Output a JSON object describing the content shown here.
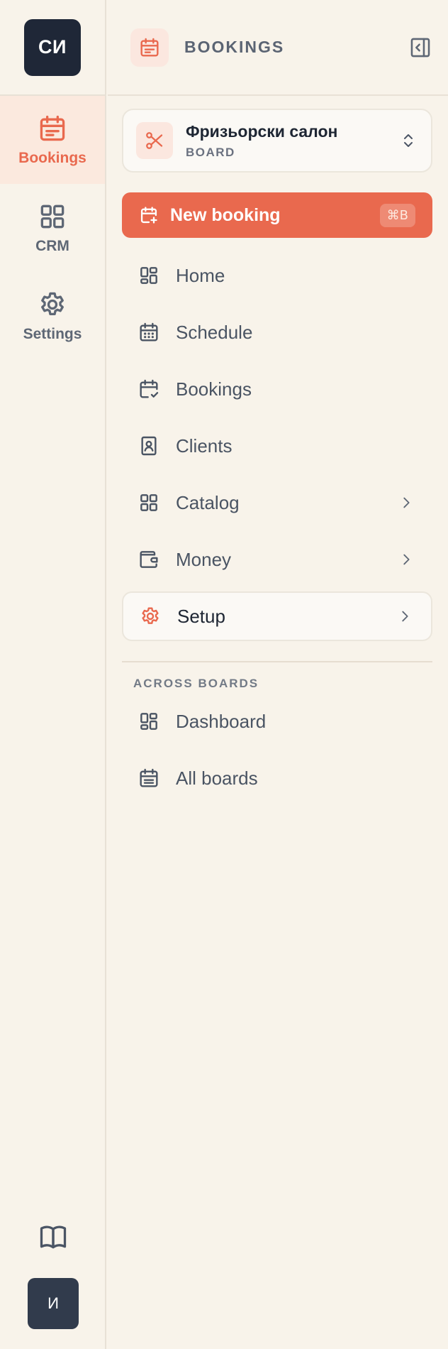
{
  "rail": {
    "logo": "СИ",
    "items": [
      {
        "label": "Bookings",
        "icon": "calendar-icon",
        "active": true
      },
      {
        "label": "CRM",
        "icon": "grid-icon",
        "active": false
      },
      {
        "label": "Settings",
        "icon": "gear-icon",
        "active": false
      }
    ],
    "bottom": {
      "help_icon": "book-icon",
      "avatar": "И"
    }
  },
  "header": {
    "icon": "calendar-icon",
    "title": "BOOKINGS",
    "collapse_icon": "collapse-sidebar-icon"
  },
  "board": {
    "name": "Фризьорски салон",
    "subtitle": "BOARD",
    "icon": "scissors-icon"
  },
  "new_booking": {
    "label": "New booking",
    "shortcut": "⌘B",
    "icon": "calendar-plus-icon"
  },
  "nav": [
    {
      "label": "Home",
      "icon": "dashboard-icon"
    },
    {
      "label": "Schedule",
      "icon": "calendar-grid-icon"
    },
    {
      "label": "Bookings",
      "icon": "calendar-check-icon"
    },
    {
      "label": "Clients",
      "icon": "contact-book-icon"
    },
    {
      "label": "Catalog",
      "icon": "grid-icon",
      "has_children": true
    },
    {
      "label": "Money",
      "icon": "wallet-icon",
      "has_children": true
    },
    {
      "label": "Setup",
      "icon": "gear-icon",
      "has_children": true,
      "selected": true
    }
  ],
  "across_boards": {
    "label": "ACROSS BOARDS",
    "items": [
      {
        "label": "Dashboard",
        "icon": "dashboard-icon"
      },
      {
        "label": "All boards",
        "icon": "calendar-grid-icon"
      }
    ]
  },
  "colors": {
    "accent": "#e9694e",
    "background": "#f8f3ea",
    "dark": "#1f2737"
  }
}
